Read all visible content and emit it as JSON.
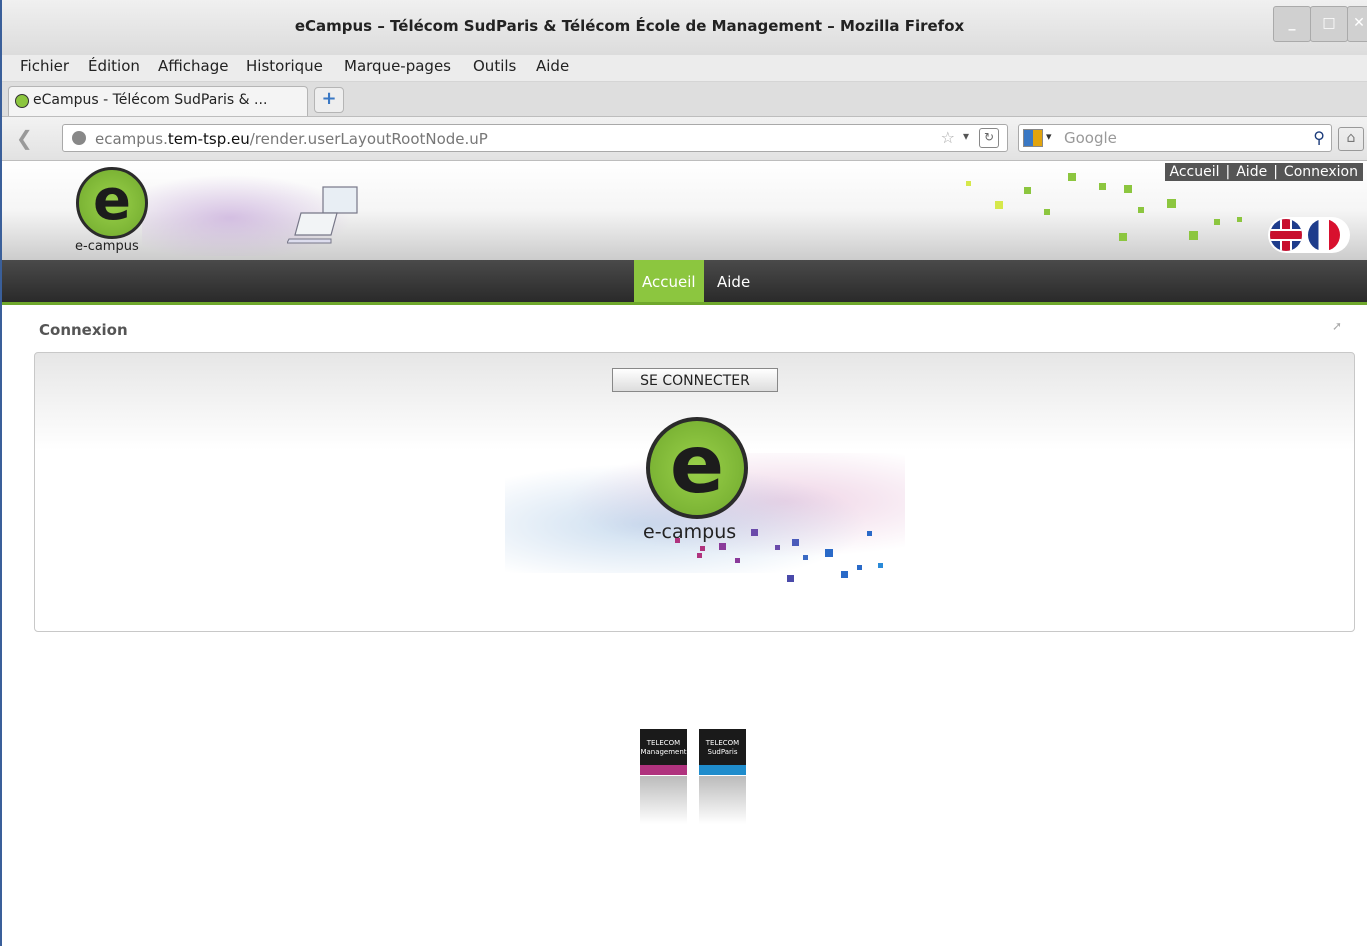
{
  "window": {
    "title": "eCampus – Télécom SudParis & Télécom École de Management – Mozilla Firefox",
    "controls": {
      "minimize": "_",
      "maximize": "□",
      "close": "✕"
    }
  },
  "menubar": [
    "Fichier",
    "Édition",
    "Affichage",
    "Historique",
    "Marque-pages",
    "Outils",
    "Aide"
  ],
  "tab": {
    "label": "eCampus - Télécom SudParis & ...",
    "new_tab": "+"
  },
  "navbar": {
    "url_host_prefix": "ecampus.",
    "url_host_domain": "tem-tsp.eu",
    "url_path": "/render.userLayoutRootNode.uP",
    "search_placeholder": "Google"
  },
  "header": {
    "logo_text": "e-campus",
    "top_links": [
      "Accueil",
      "Aide",
      "Connexion"
    ],
    "separator": "|"
  },
  "nav": {
    "items": [
      {
        "label": "Accueil",
        "active": true
      },
      {
        "label": "Aide",
        "active": false
      }
    ]
  },
  "portlet": {
    "title": "Connexion",
    "connect_button": "SE CONNECTER",
    "logo_text": "e-campus"
  },
  "footer": {
    "logos": [
      {
        "name": "TELECOM École de Management",
        "line1": "TELECOM",
        "line2": "Management",
        "bar_color": "#b0337e"
      },
      {
        "name": "TELECOM SudParis",
        "line1": "TELECOM",
        "line2": "SudParis",
        "bar_color": "#1f8ccc"
      }
    ]
  },
  "colors": {
    "accent": "#8cc63f",
    "nav_dark": "#333333"
  }
}
